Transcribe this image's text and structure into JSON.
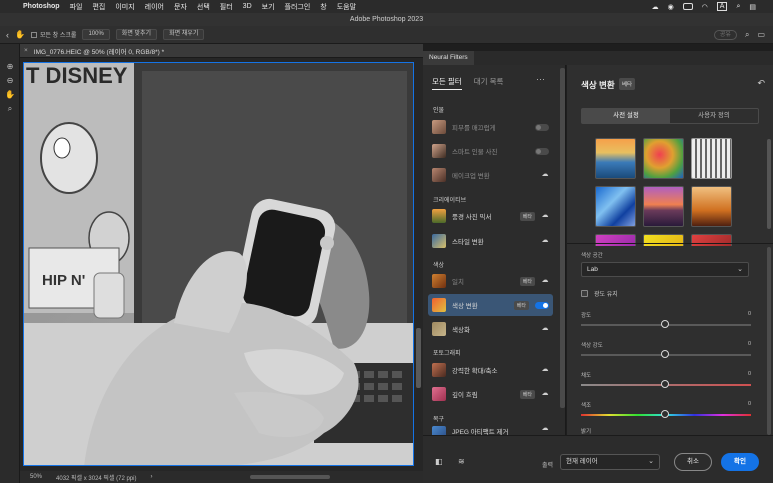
{
  "menubar": {
    "app_name": "Photoshop",
    "items": [
      "파일",
      "편집",
      "이미지",
      "레이어",
      "문자",
      "선택",
      "필터",
      "3D",
      "보기",
      "플러그인",
      "창",
      "도움말"
    ]
  },
  "window_title": "Adobe Photoshop 2023",
  "options_bar": {
    "scroll_all_label": "모든 창 스크롤",
    "zoom_value": "100%",
    "fit_screen_label": "화면 맞추기",
    "fill_screen_label": "화면 채우기",
    "share_label": "공유"
  },
  "document": {
    "tab_title": "IMG_0776.HEIC @ 50% (레이어 0, RGB/8*) *",
    "status_zoom": "50%",
    "status_info": "4032 픽셀 x 3024 픽셀 (72 ppi)"
  },
  "neural_filters": {
    "panel_tab": "Neural Filters",
    "nav_all": "모든 필터",
    "nav_waitlist": "대기 목록",
    "more_icon": "ellipsis-icon",
    "categories": {
      "portraits": "인물",
      "creative": "크리에이티브",
      "color": "색상",
      "photography": "포토그래피",
      "restoration": "복구"
    },
    "beta_label": "베타",
    "items": {
      "skin": "피부를 매끄럽게",
      "smart_portrait": "스마트 인물 사진",
      "makeup": "메이크업 변환",
      "landscape": "풍경 사진 믹서",
      "style": "스타일 변환",
      "harmonize": "일치",
      "color_transfer": "색상 변환",
      "colorize": "색상화",
      "super_zoom": "강력한 확대/축소",
      "depth_blur": "깊이 흐림",
      "jpeg_artifacts": "JPEG 아티팩트 제거"
    },
    "settings": {
      "title": "색상 변환",
      "beta": "베타",
      "tab_presets": "사전 설정",
      "tab_custom": "사용자 정의",
      "color_space_label": "색상 공간",
      "color_space_value": "Lab",
      "preserve_luminance": "광도 유지",
      "sliders": [
        {
          "label": "광도",
          "value": "0"
        },
        {
          "label": "색상 강도",
          "value": "0"
        },
        {
          "label": "채도",
          "value": "0"
        },
        {
          "label": "색조",
          "value": "0"
        },
        {
          "label": "밝기",
          "value": ""
        }
      ]
    },
    "bottom": {
      "output_label": "출력",
      "output_value": "현재 레이어",
      "cancel": "취소",
      "ok": "확인"
    }
  }
}
